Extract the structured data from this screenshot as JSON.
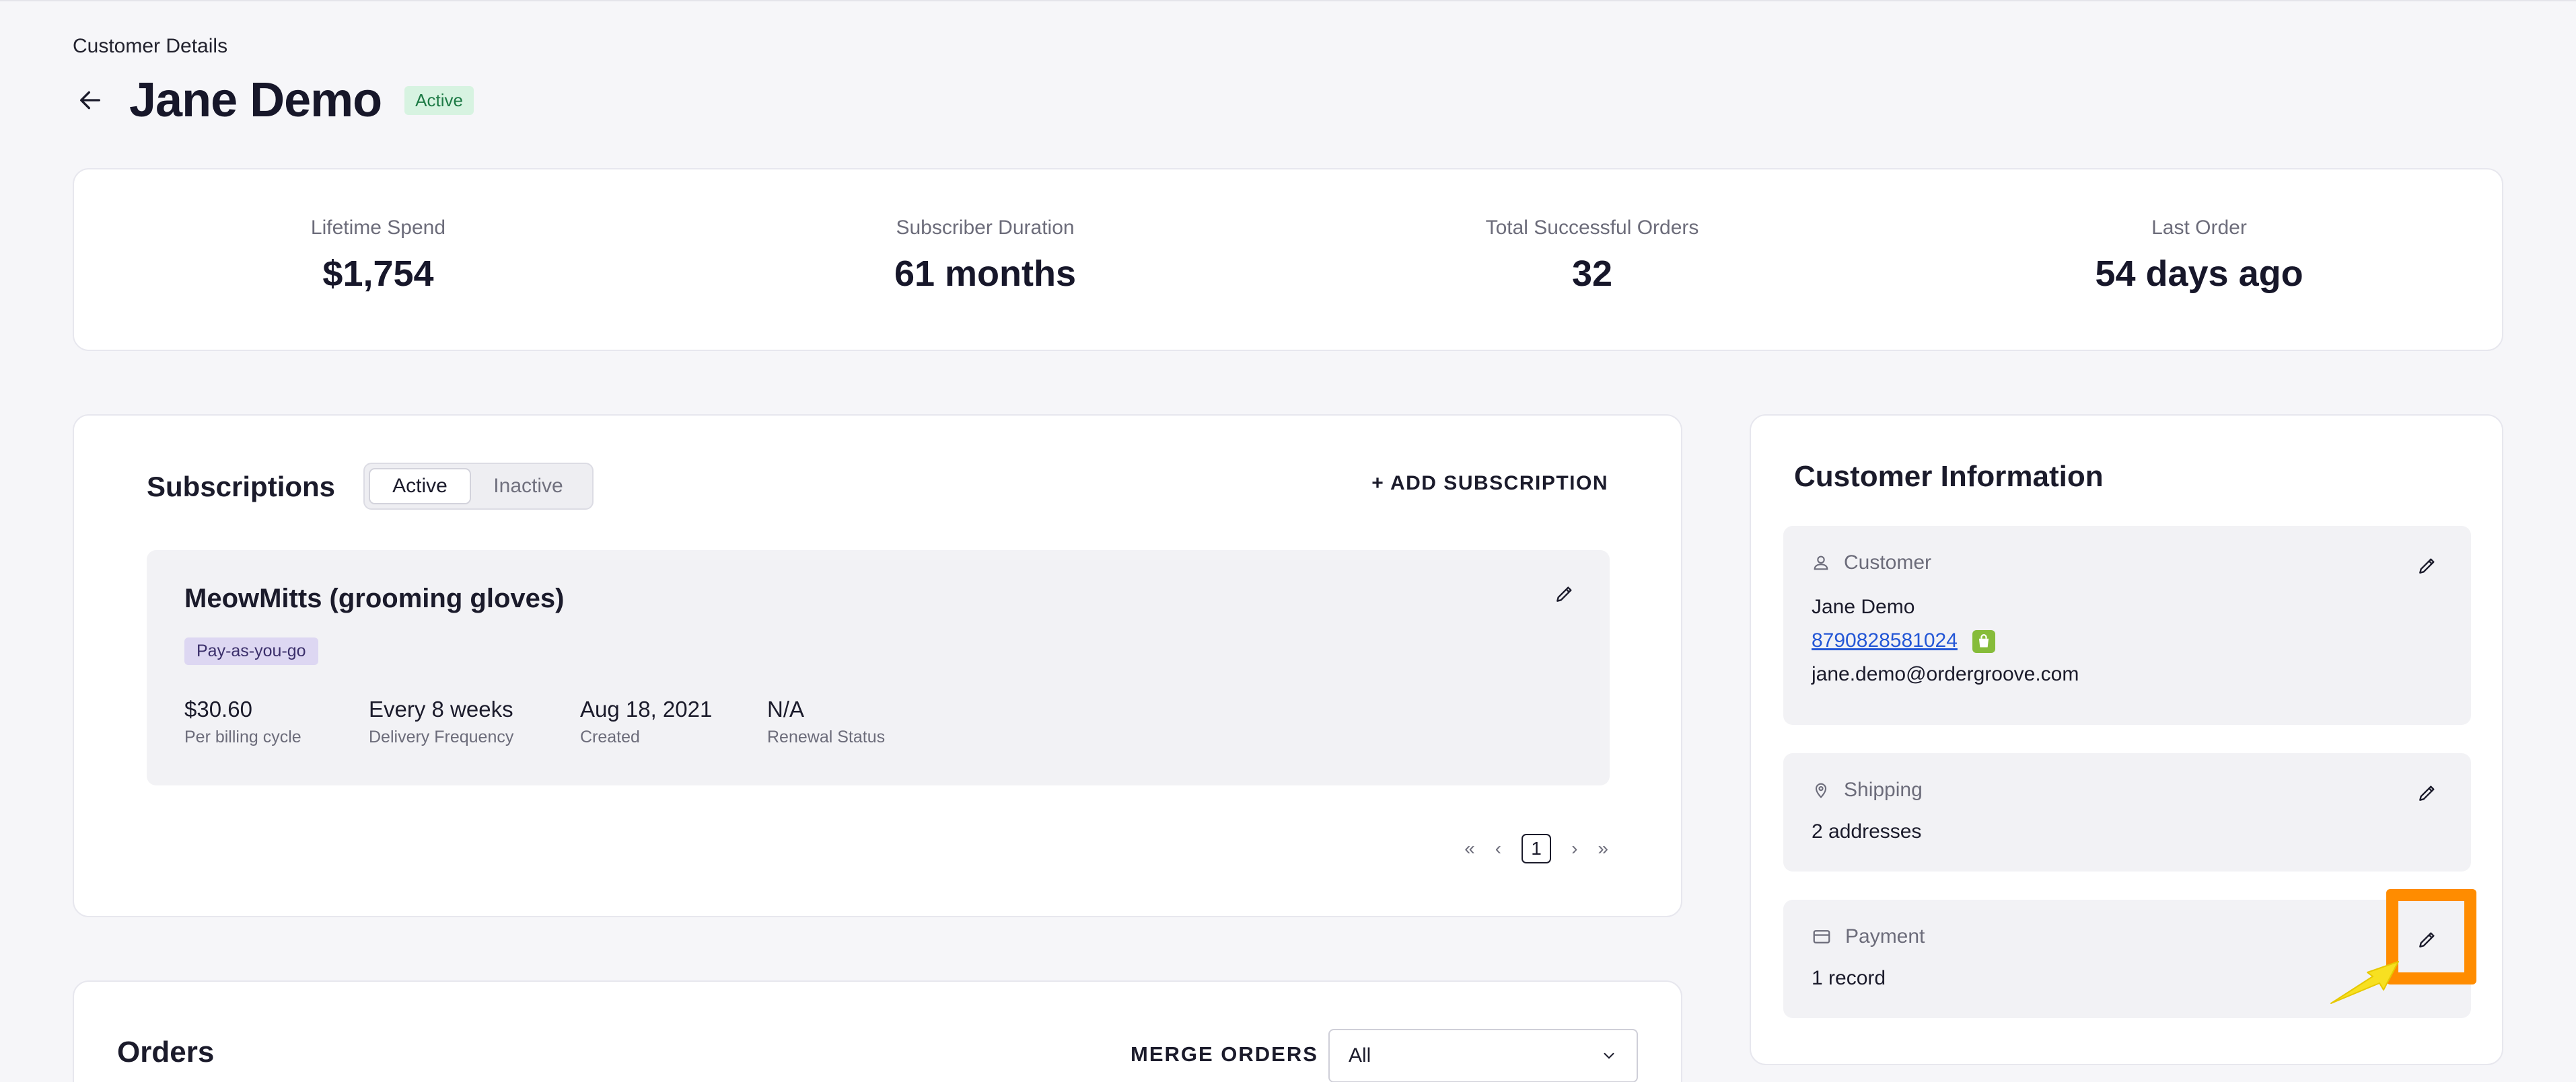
{
  "header": {
    "breadcrumb": "Customer Details",
    "title": "Jane Demo",
    "status": "Active"
  },
  "stats": [
    {
      "label": "Lifetime Spend",
      "value": "$1,754"
    },
    {
      "label": "Subscriber Duration",
      "value": "61 months"
    },
    {
      "label": "Total Successful Orders",
      "value": "32"
    },
    {
      "label": "Last Order",
      "value": "54 days ago"
    }
  ],
  "subscriptions": {
    "title": "Subscriptions",
    "tabs": [
      "Active",
      "Inactive"
    ],
    "add_label": "+ ADD SUBSCRIPTION",
    "item": {
      "name": "MeowMitts (grooming gloves)",
      "badge": "Pay-as-you-go",
      "fields": [
        {
          "value": "$30.60",
          "label": "Per billing cycle"
        },
        {
          "value": "Every 8 weeks",
          "label": "Delivery Frequency"
        },
        {
          "value": "Aug 18, 2021",
          "label": "Created"
        },
        {
          "value": "N/A",
          "label": "Renewal Status"
        }
      ]
    },
    "pagination": {
      "first": "«",
      "prev": "‹",
      "current": "1",
      "next": "›",
      "last": "»"
    }
  },
  "customer_info": {
    "title": "Customer Information",
    "customer": {
      "heading": "Customer",
      "name": "Jane Demo",
      "phone": "8790828581024",
      "email": "jane.demo@ordergroove.com"
    },
    "shipping": {
      "heading": "Shipping",
      "value": "2 addresses"
    },
    "payment": {
      "heading": "Payment",
      "value": "1 record"
    }
  },
  "orders": {
    "title": "Orders",
    "merge_label": "MERGE ORDERS",
    "filter_value": "All"
  },
  "colors": {
    "highlight": "#ff8c00",
    "arrow": "#f7e021",
    "link": "#2457d6",
    "active_badge_bg": "#d7f3e1"
  },
  "icons": [
    "back-arrow-icon",
    "pencil-icon",
    "person-icon",
    "location-pin-icon",
    "credit-card-icon",
    "shopify-bag-icon",
    "chevron-down-icon"
  ]
}
